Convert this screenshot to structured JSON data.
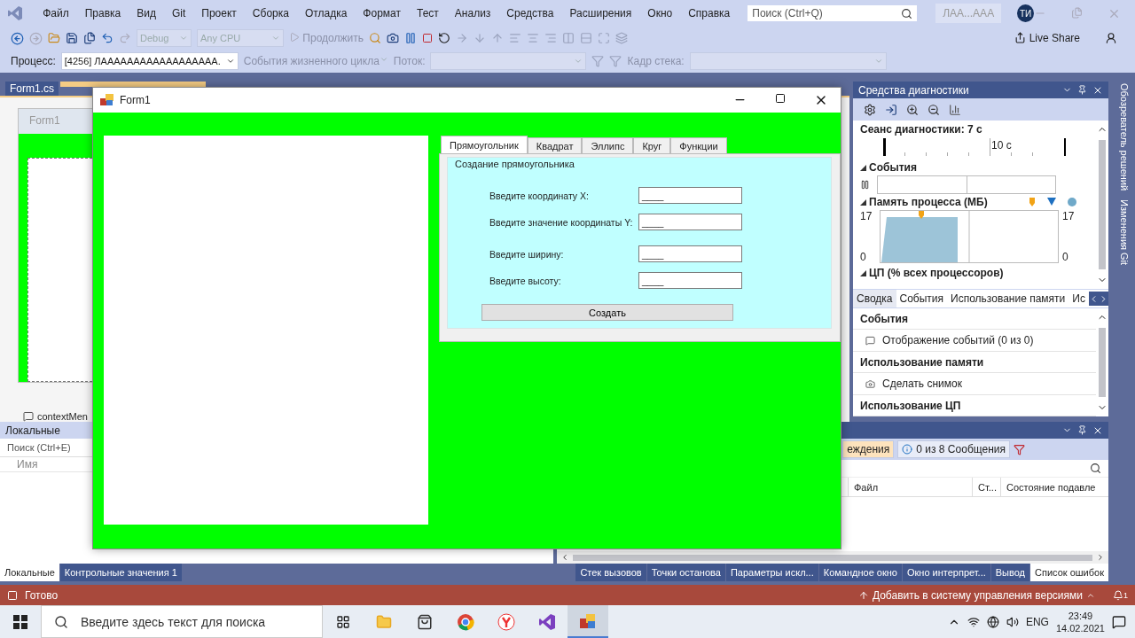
{
  "menu": {
    "items": [
      "Файл",
      "Правка",
      "Вид",
      "Git",
      "Проект",
      "Сборка",
      "Отладка",
      "Формат",
      "Тест",
      "Анализ",
      "Средства",
      "Расширения",
      "Окно",
      "Справка"
    ],
    "search": {
      "placeholder": "Поиск (Ctrl+Q)"
    },
    "solution": "ЛАА...ААА",
    "avatar": "ТИ"
  },
  "toolbar": {
    "configuration": "Debug",
    "platform": "Any CPU",
    "continue": "Продолжить",
    "live_share": "Live Share"
  },
  "debug_location": {
    "process_label": "Процесс:",
    "process": "[4256] ЛАААААААААААААААААА.",
    "lifecycle": "События жизненного цикла",
    "thread_label": "Поток:",
    "stack_label": "Кадр стека:"
  },
  "editor": {
    "tabs": [
      {
        "label": "Form1.cs",
        "selected": false
      }
    ],
    "designer_title": "Form1",
    "tray_item": "contextMen"
  },
  "form_window": {
    "title": "Form1",
    "tabs": [
      {
        "label": "Прямоугольник",
        "selected": true
      },
      {
        "label": "Квадрат",
        "selected": false
      },
      {
        "label": "Эллипс",
        "selected": false
      },
      {
        "label": "Круг",
        "selected": false
      },
      {
        "label": "Функции",
        "selected": false
      }
    ],
    "group": "Создание прямоугольника",
    "fields": [
      {
        "label": "Введите координату X:",
        "value": "____"
      },
      {
        "label": "Введите значение координаты Y:",
        "value": "____"
      },
      {
        "label": "Введите ширину:",
        "value": "____"
      },
      {
        "label": "Введите высоту:",
        "value": "____"
      }
    ],
    "button": "Создать"
  },
  "diagnostics": {
    "title": "Средства диагностики",
    "session": "Сеанс диагностики: 7 с",
    "timeline_label": "10 с",
    "events_title": "События",
    "memory_title": "Память процесса (МБ)",
    "memory_axis_left": {
      "max": "17",
      "min": "0"
    },
    "memory_axis_right": {
      "max": "17",
      "min": "0"
    },
    "cpu_title": "ЦП (% всех процессоров)",
    "tabs": [
      {
        "label": "Сводка",
        "selected": true
      },
      {
        "label": "События",
        "selected": false
      },
      {
        "label": "Использование памяти",
        "selected": false
      },
      {
        "label": "Ис",
        "selected": false
      }
    ],
    "sections": [
      {
        "title": "События",
        "item": "Отображение событий (0 из 0)"
      },
      {
        "title": "Использование памяти",
        "item": "Сделать снимок"
      },
      {
        "title": "Использование ЦП"
      }
    ]
  },
  "side_tabs": [
    "Обозреватель решений",
    "Изменения Git"
  ],
  "locals": {
    "title": "Локальные",
    "search": {
      "placeholder": "Поиск (Ctrl+E)"
    },
    "columns": [
      "Имя"
    ],
    "tabs": [
      {
        "label": "Локальные",
        "selected": true
      },
      {
        "label": "Контрольные значения 1",
        "selected": false
      }
    ]
  },
  "error_list": {
    "filters": [
      {
        "label": "еждения",
        "selected": true
      },
      {
        "label": "0 из 8 Сообщения",
        "selected": false
      }
    ],
    "columns": [
      "Файл",
      "Ст...",
      "Состояние подавле"
    ],
    "tabs": [
      {
        "label": "Стек вызовов",
        "selected": false
      },
      {
        "label": "Точки останова",
        "selected": false
      },
      {
        "label": "Параметры искл...",
        "selected": false
      },
      {
        "label": "Командное окно",
        "selected": false
      },
      {
        "label": "Окно интерпрет...",
        "selected": false
      },
      {
        "label": "Вывод",
        "selected": false
      },
      {
        "label": "Список ошибок",
        "selected": true
      }
    ]
  },
  "status_bar": {
    "text": "Готово",
    "source_control": "Добавить в систему управления версиями",
    "notifications": "1"
  },
  "taskbar": {
    "search": {
      "placeholder": "Введите здесь текст для поиска"
    },
    "language": "ENG",
    "time": "23:49",
    "date": "14.02.2021"
  }
}
